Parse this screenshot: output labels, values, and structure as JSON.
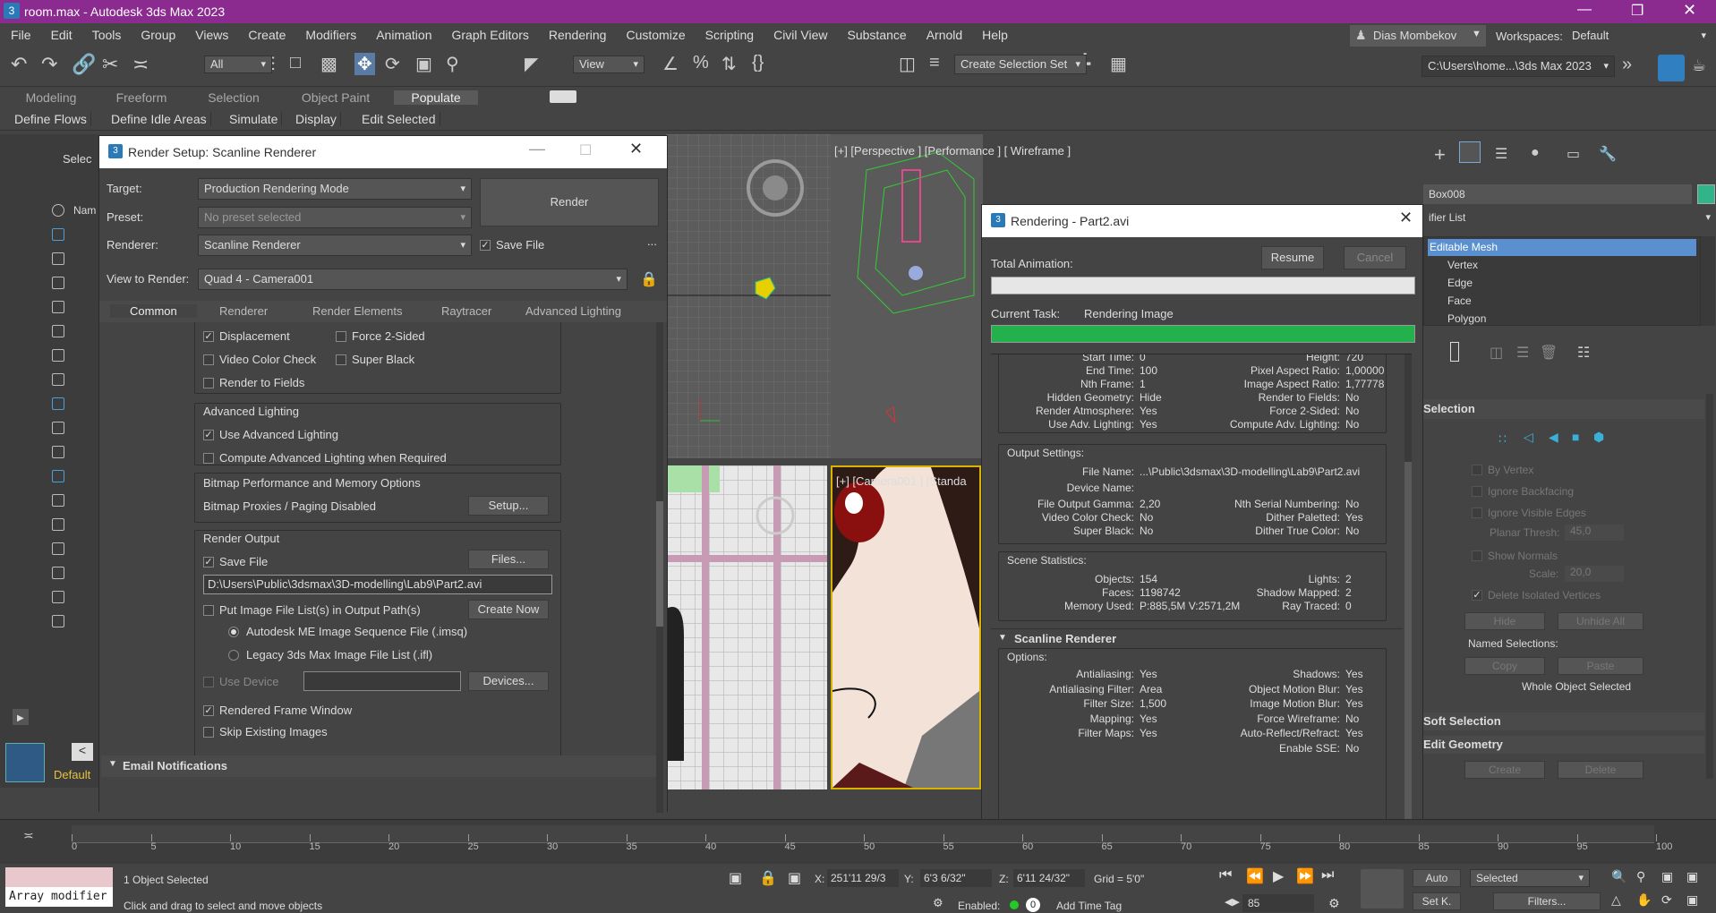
{
  "app": {
    "title": "room.max - Autodesk 3ds Max 2023",
    "title_bar_color": "#8b2a8f"
  },
  "menu": [
    "File",
    "Edit",
    "Tools",
    "Group",
    "Views",
    "Create",
    "Modifiers",
    "Animation",
    "Graph Editors",
    "Rendering",
    "Customize",
    "Scripting",
    "Civil View",
    "Substance",
    "Arnold",
    "Help"
  ],
  "user": {
    "name": "Dias Mombekov",
    "workspaces_label": "Workspaces:",
    "workspace": "Default"
  },
  "toolbar": {
    "filter": "All",
    "ref_coord": "View",
    "selection_set": "Create Selection Set",
    "path": "C:\\Users\\home...\\3ds Max 2023"
  },
  "ribbon_tabs": [
    "Modeling",
    "Freeform",
    "Selection",
    "Object Paint",
    "Populate"
  ],
  "ribbon_buttons": [
    "Define Flows",
    "Define Idle Areas",
    "Simulate",
    "Display",
    "Edit Selected"
  ],
  "scene_explorer": {
    "select_label": "Selec",
    "name_col": "Nam",
    "default_label": "Default"
  },
  "render_setup": {
    "title": "Render Setup: Scanline Renderer",
    "target_label": "Target:",
    "target": "Production Rendering Mode",
    "preset_label": "Preset:",
    "preset": "No preset selected",
    "renderer_label": "Renderer:",
    "renderer": "Scanline Renderer",
    "save_file": "Save File",
    "view_label": "View to Render:",
    "view": "Quad 4 - Camera001",
    "render_btn": "Render",
    "more": "...",
    "tabs": [
      "Common",
      "Renderer",
      "Render Elements",
      "Raytracer",
      "Advanced Lighting"
    ],
    "displacement": "Displacement",
    "force2": "Force 2-Sided",
    "video_color": "Video Color Check",
    "super_black": "Super Black",
    "render_fields": "Render to Fields",
    "adv_light_title": "Advanced Lighting",
    "use_adv": "Use Advanced Lighting",
    "compute_adv": "Compute Advanced Lighting when Required",
    "bitmap_title": "Bitmap Performance and Memory Options",
    "bitmap_proxies": "Bitmap Proxies / Paging Disabled",
    "setup_btn": "Setup...",
    "output_title": "Render Output",
    "save_file2": "Save File",
    "files_btn": "Files...",
    "output_path": "D:\\Users\\Public\\3dsmax\\3D-modelling\\Lab9\\Part2.avi",
    "put_image": "Put Image File List(s) in Output Path(s)",
    "create_now": "Create Now",
    "imsq": "Autodesk ME Image Sequence File (.imsq)",
    "ifl": "Legacy 3ds Max Image File List (.ifl)",
    "use_device": "Use Device",
    "devices_btn": "Devices...",
    "rendered_frame": "Rendered Frame Window",
    "skip_existing": "Skip Existing Images",
    "email": "Email Notifications"
  },
  "viewports": {
    "top_right": "[+] [Perspective ] [Performance ] [ Wireframe ]",
    "bottom_right": "[+] [Camera001 ] [Standa"
  },
  "rendering": {
    "title": "Rendering - Part2.avi",
    "total_anim": "Total Animation:",
    "resume": "Resume",
    "cancel": "Cancel",
    "current_task_label": "Current Task:",
    "current_task": "Rendering Image",
    "total_progress": 0.0,
    "task_progress": 1.0,
    "params_top": [
      [
        "Start Time:",
        "0",
        "Height:",
        "720"
      ],
      [
        "End Time:",
        "100",
        "Pixel Aspect Ratio:",
        "1,00000"
      ],
      [
        "Nth Frame:",
        "1",
        "Image Aspect Ratio:",
        "1,77778"
      ],
      [
        "Hidden Geometry:",
        "Hide",
        "Render to Fields:",
        "No"
      ],
      [
        "Render Atmosphere:",
        "Yes",
        "Force 2-Sided:",
        "No"
      ],
      [
        "Use Adv. Lighting:",
        "Yes",
        "Compute Adv. Lighting:",
        "No"
      ]
    ],
    "output_settings": "Output Settings:",
    "file_name_label": "File Name:",
    "file_name": "...\\Public\\3dsmax\\3D-modelling\\Lab9\\Part2.avi",
    "device_name_label": "Device Name:",
    "output_rows": [
      [
        "File Output Gamma:",
        "2,20",
        "Nth Serial Numbering:",
        "No"
      ],
      [
        "Video Color Check:",
        "No",
        "Dither Paletted:",
        "Yes"
      ],
      [
        "Super Black:",
        "No",
        "Dither True Color:",
        "No"
      ]
    ],
    "scene_stats": "Scene Statistics:",
    "stats_rows": [
      [
        "Objects:",
        "154",
        "Lights:",
        "2"
      ],
      [
        "Faces:",
        "1198742",
        "Shadow Mapped:",
        "2"
      ],
      [
        "Memory Used:",
        "P:885,5M V:2571,2M",
        "Ray Traced:",
        "0"
      ]
    ],
    "scanline_title": "Scanline Renderer",
    "options_label": "Options:",
    "options_rows": [
      [
        "Antialiasing:",
        "Yes",
        "Shadows:",
        "Yes"
      ],
      [
        "Antialiasing Filter:",
        "Area",
        "Object Motion Blur:",
        "Yes"
      ],
      [
        "Filter Size:",
        "1,500",
        "Image Motion Blur:",
        "Yes"
      ],
      [
        "Mapping:",
        "Yes",
        "Force Wireframe:",
        "No"
      ],
      [
        "Filter Maps:",
        "Yes",
        "Auto-Reflect/Refract:",
        "Yes"
      ],
      [
        "",
        "",
        "Enable SSE:",
        "No"
      ]
    ]
  },
  "command_panel": {
    "object_name": "Box008",
    "modifier_list": "ifier List",
    "stack": [
      "Editable Mesh",
      "Vertex",
      "Edge",
      "Face",
      "Polygon"
    ],
    "selection_title": "Selection",
    "by_vertex": "By Vertex",
    "ignore_backfacing": "Ignore Backfacing",
    "ignore_visible": "Ignore Visible Edges",
    "planar_thresh": "Planar Thresh:",
    "planar_val": "45,0",
    "show_normals": "Show Normals",
    "scale_label": "Scale:",
    "scale_val": "20,0",
    "delete_isolated": "Delete Isolated Vertices",
    "hide": "Hide",
    "unhide_all": "Unhide All",
    "named_sel": "Named Selections:",
    "copy": "Copy",
    "paste": "Paste",
    "whole_obj": "Whole Object Selected",
    "soft_sel": "Soft Selection",
    "edit_geo": "Edit Geometry",
    "create": "Create",
    "delete": "Delete"
  },
  "timeline": {
    "ticks": [
      "0",
      "5",
      "10",
      "15",
      "20",
      "25",
      "30",
      "35",
      "40",
      "45",
      "50",
      "55",
      "60",
      "65",
      "70",
      "75",
      "80",
      "85",
      "90",
      "95",
      "100"
    ]
  },
  "status": {
    "maxscript": "Array modifier",
    "objects_selected": "1 Object Selected",
    "prompt": "Click and drag to select and move objects",
    "x_label": "X:",
    "x": "251'11 29/3",
    "y_label": "Y:",
    "y": "6'3 6/32\"",
    "z_label": "Z:",
    "z": "6'11 24/32\"",
    "grid": "Grid = 5'0\"",
    "enabled": "Enabled:",
    "enabled_val": "0",
    "add_time_tag": "Add Time Tag",
    "frame": "85",
    "auto": "Auto",
    "selected": "Selected",
    "set_key": "Set K.",
    "filters": "Filters..."
  }
}
